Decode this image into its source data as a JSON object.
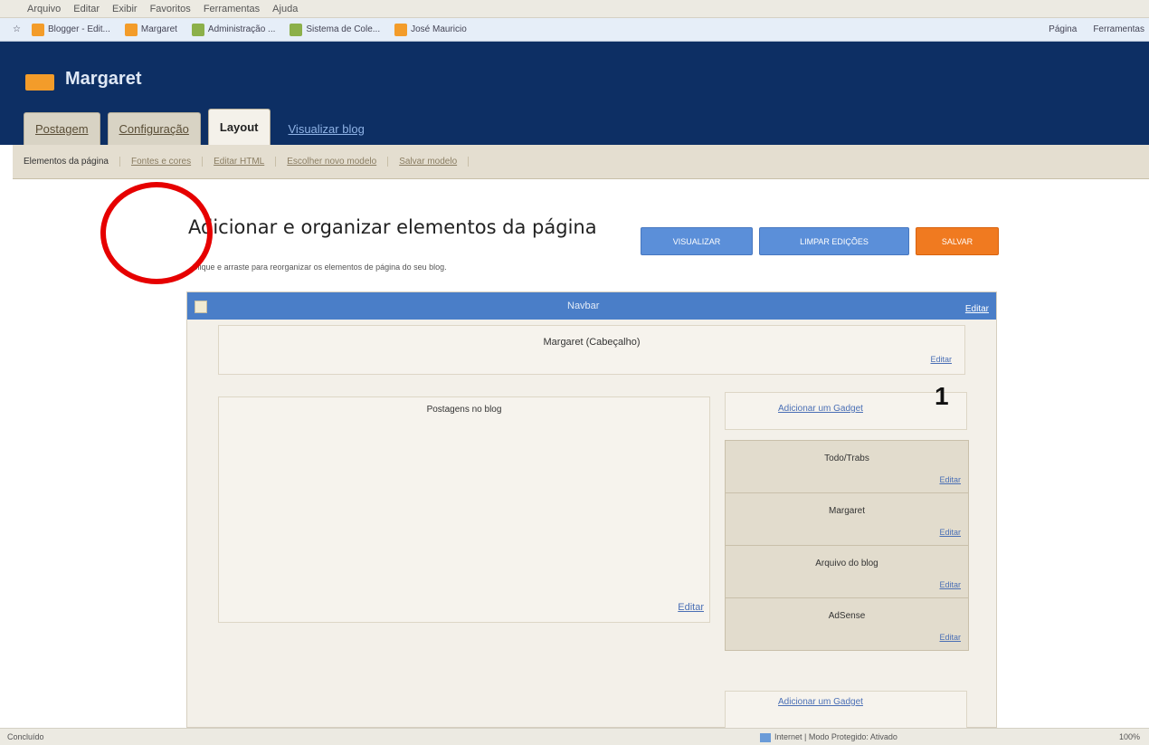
{
  "browser": {
    "menu": [
      "Arquivo",
      "Editar",
      "Exibir",
      "Favoritos",
      "Ferramentas",
      "Ajuda"
    ],
    "favorites": [
      "Blogger - Edit...",
      "Margaret",
      "Administração ...",
      "Sistema de Cole...",
      "José Mauricio"
    ],
    "tools": [
      "Página",
      "Ferramentas"
    ],
    "status": {
      "left": "Concluído",
      "zone": "Internet | Modo Protegido: Ativado",
      "zoom": "100%"
    }
  },
  "blog": {
    "name": "Margaret"
  },
  "tabs": {
    "items": [
      "Postagem",
      "Configuração",
      "Layout"
    ],
    "view_blog": "Visualizar blog"
  },
  "subnav": [
    "Elementos da página",
    "Fontes e cores",
    "Editar HTML",
    "Escolher novo modelo",
    "Salvar modelo"
  ],
  "page": {
    "title": "Adicionar e organizar elementos da página",
    "subtitle": "Clique e arraste para reorganizar os elementos de página do seu blog.",
    "buttons": {
      "preview": "VISUALIZAR",
      "clear": "LIMPAR EDIÇÕES",
      "save": "SALVAR"
    }
  },
  "editor": {
    "navbar": {
      "label": "Navbar",
      "edit": "Editar"
    },
    "header": {
      "title": "Margaret (Cabeçalho)",
      "edit": "Editar"
    },
    "posts": {
      "title": "Postagens no blog",
      "edit": "Editar"
    },
    "add_gadget": "Adicionar um Gadget",
    "annotation": "1",
    "gadgets": [
      {
        "title": "Todo/Trabs",
        "edit": "Editar"
      },
      {
        "title": "Margaret",
        "edit": "Editar"
      },
      {
        "title": "Arquivo do blog",
        "edit": "Editar"
      },
      {
        "title": "AdSense",
        "edit": "Editar"
      }
    ],
    "add_gadget_bottom": "Adicionar um Gadget"
  },
  "colors": {
    "header_blue": "#0d2f64",
    "accent_blue": "#4a7ec8",
    "save_orange": "#f07a20",
    "annotation_red": "#e60000"
  }
}
